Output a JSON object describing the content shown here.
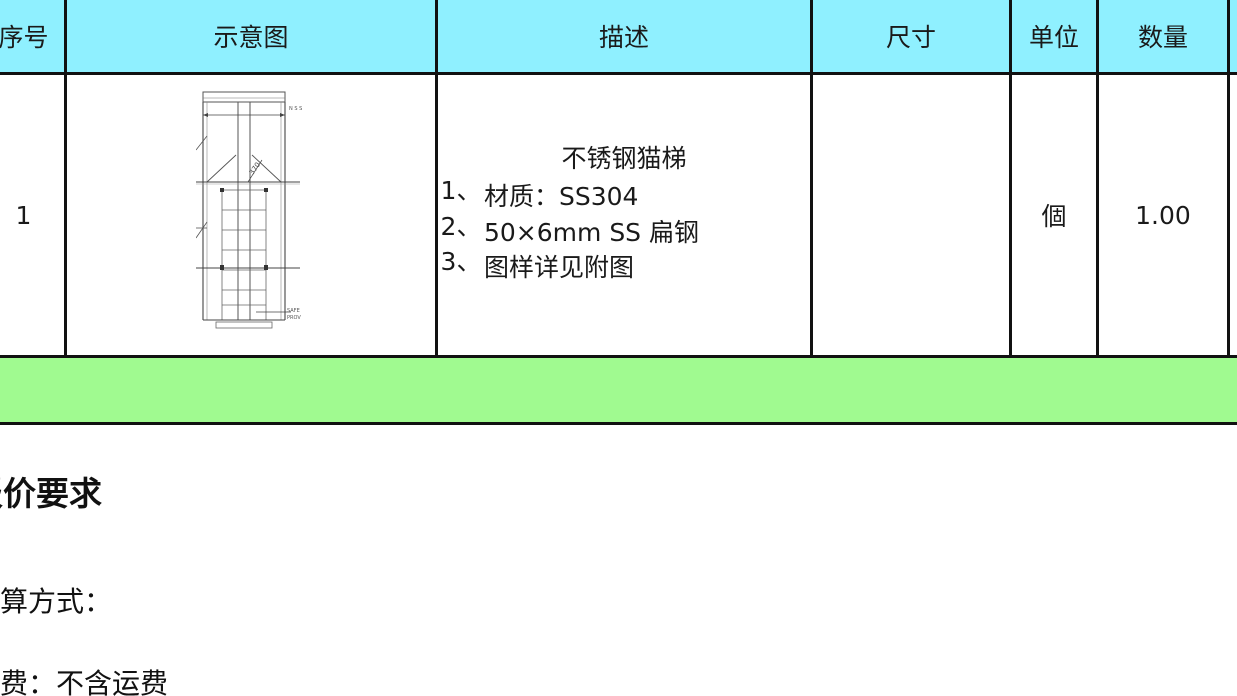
{
  "table": {
    "headers": {
      "no": "序号",
      "diagram": "示意图",
      "description": "描述",
      "size": "尺寸",
      "unit": "单位",
      "quantity": "数量"
    },
    "rows": [
      {
        "no": "1",
        "description": {
          "title": "不锈钢猫梯",
          "items": [
            {
              "num": "1、",
              "text": "材质：SS304"
            },
            {
              "num": "2、",
              "text": "50×6mm SS 扁钢"
            },
            {
              "num": "3、",
              "text": "图样详见附图"
            }
          ]
        },
        "size": "",
        "unit": "個",
        "quantity": "1.00"
      }
    ]
  },
  "diagram_labels": {
    "top_note": "N S S",
    "dim": "370",
    "bottom_note_1": "SAFE",
    "bottom_note_2": "PROV"
  },
  "section_title": "报价要求",
  "paragraphs": {
    "settlement": "结算方式：",
    "freight": "运费：不含运费"
  },
  "colors": {
    "header_bg": "#8ff0ff",
    "total_row_bg": "#a0fa90",
    "border": "#111111"
  }
}
